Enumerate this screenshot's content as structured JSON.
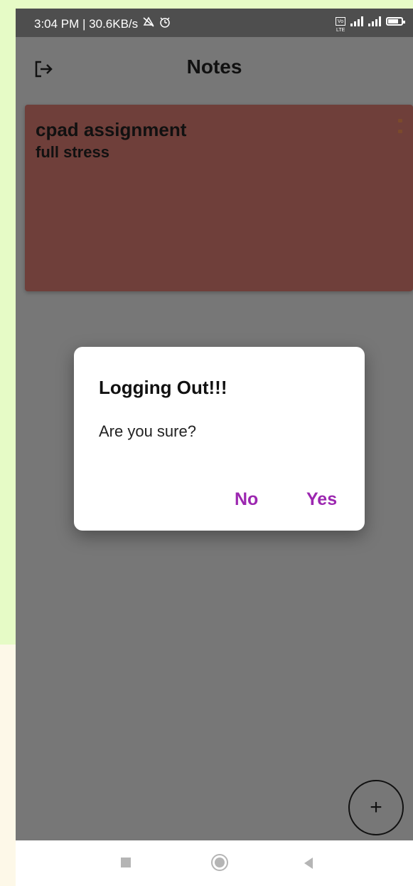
{
  "status_bar": {
    "time_speed": "3:04 PM | 30.6KB/s",
    "icons": [
      "mute-icon",
      "alarm-icon",
      "volte-icon",
      "signal-4g-icon",
      "signal-icon",
      "battery-icon"
    ],
    "volte_label": "Vo LTE",
    "network_label": "4G"
  },
  "app_bar": {
    "title": "Notes",
    "logout_icon": "logout-icon"
  },
  "notes": [
    {
      "title": "cpad assignment",
      "body": "full stress",
      "color": "#6f3f3a"
    }
  ],
  "dialog": {
    "title": "Logging Out!!!",
    "message": "Are you sure?",
    "buttons": {
      "no": "No",
      "yes": "Yes"
    },
    "accent_color": "#9c27b0"
  },
  "fab": {
    "label": "+",
    "icon": "plus-icon"
  },
  "nav_bar": {
    "icons": [
      "recents-icon",
      "home-icon",
      "back-icon"
    ]
  }
}
